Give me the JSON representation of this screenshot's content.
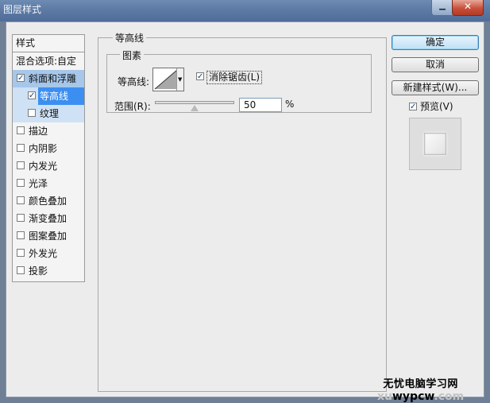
{
  "window": {
    "title": "图层样式",
    "close_glyph": "✕",
    "min_glyph": "▁"
  },
  "styles_panel": {
    "header": "样式",
    "blend_options": "混合选项:自定",
    "items": [
      {
        "label": "斜面和浮雕",
        "checked": true,
        "state": "selected"
      },
      {
        "label": "等高线",
        "checked": true,
        "state": "active",
        "sub": true
      },
      {
        "label": "纹理",
        "checked": false,
        "state": "sub",
        "sub": true
      },
      {
        "label": "描边",
        "checked": false
      },
      {
        "label": "内阴影",
        "checked": false
      },
      {
        "label": "内发光",
        "checked": false
      },
      {
        "label": "光泽",
        "checked": false
      },
      {
        "label": "颜色叠加",
        "checked": false
      },
      {
        "label": "渐变叠加",
        "checked": false
      },
      {
        "label": "图案叠加",
        "checked": false
      },
      {
        "label": "外发光",
        "checked": false
      },
      {
        "label": "投影",
        "checked": false
      }
    ]
  },
  "contour_panel": {
    "group_title": "等高线",
    "subgroup_title": "图素",
    "contour_label": "等高线:",
    "antialias_label": "消除锯齿(L)",
    "antialias_checked": true,
    "range_label": "范围(R):",
    "range_value": "50",
    "range_percent": 50,
    "range_unit": "%"
  },
  "actions": {
    "ok": "确定",
    "cancel": "取消",
    "new_style": "新建样式(W)...",
    "preview_label": "预览(V)",
    "preview_checked": true
  },
  "watermark": {
    "line1": "无忧电脑学习网",
    "line2_visible": "wypcw",
    "line2_faint": ".com",
    "prefix_faint": "xu"
  },
  "icons": [
    "checkbox-checked-icon",
    "dropdown-arrow-icon",
    "slider-thumb-icon",
    "contour-curve-icon"
  ]
}
